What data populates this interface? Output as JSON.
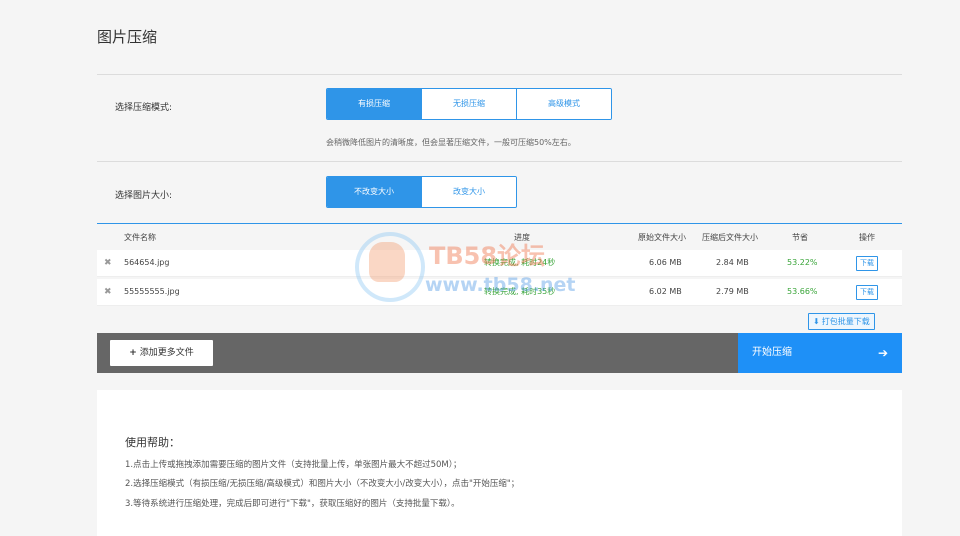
{
  "title": "图片压缩",
  "compress_mode": {
    "label": "选择压缩模式:",
    "options": [
      "有损压缩",
      "无损压缩",
      "高级模式"
    ],
    "selected": "有损压缩",
    "hint": "会稍微降低图片的清晰度，但会显著压缩文件，一般可压缩50%左右。"
  },
  "size_mode": {
    "label": "选择图片大小:",
    "options": [
      "不改变大小",
      "改变大小"
    ],
    "selected": "不改变大小"
  },
  "table": {
    "columns": [
      "文件名称",
      "进度",
      "原始文件大小",
      "压缩后文件大小",
      "节省",
      "操作"
    ],
    "rows": [
      {
        "name": "564654.jpg",
        "progress": "转换完成, 耗时24秒",
        "original": "6.06 MB",
        "compressed": "2.84 MB",
        "saved": "53.22%",
        "action": "下载"
      },
      {
        "name": "55555555.jpg",
        "progress": "转换完成, 耗时35秒",
        "original": "6.02 MB",
        "compressed": "2.79 MB",
        "saved": "53.66%",
        "action": "下载"
      }
    ],
    "batch_download": "打包批量下载"
  },
  "toolbar": {
    "add_more": "添加更多文件",
    "start": "开始压缩"
  },
  "help": {
    "heading": "使用帮助：",
    "lines": [
      "1.点击上传或拖拽添加需要压缩的图片文件（支持批量上传，单张图片最大不超过50M）；",
      "2.选择压缩模式（有损压缩/无损压缩/高级模式）和图片大小（不改变大小/改变大小），点击\"开始压缩\"；",
      "3.等待系统进行压缩处理，完成后即可进行\"下载\"，获取压缩好的图片（支持批量下载）。"
    ]
  },
  "watermark": {
    "line1": "TB58论坛",
    "line2": "www.tb58.net"
  },
  "colors": {
    "accent": "#2f95e8",
    "start_button": "#1e90f7",
    "toolbar_bg": "#666666",
    "success_text": "#3aa53a"
  }
}
